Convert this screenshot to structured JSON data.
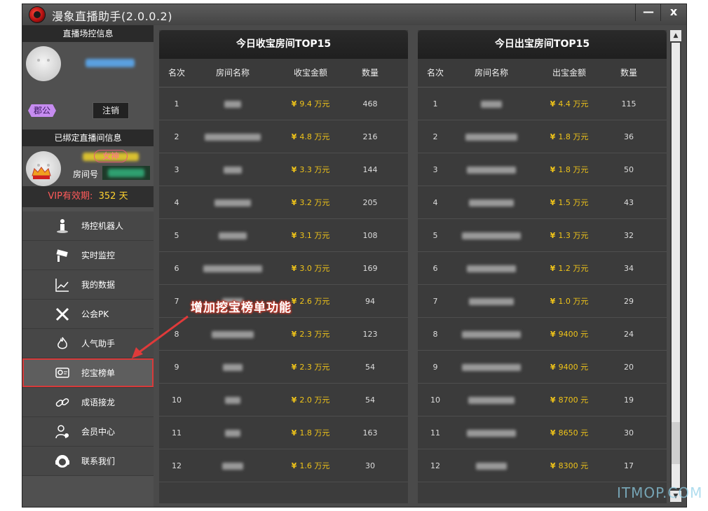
{
  "window": {
    "title": "漫象直播助手(2.0.0.2)",
    "minimize": "—",
    "close": "x"
  },
  "left": {
    "control_header": "直播场控信息",
    "union_badge": "郡公",
    "logout_label": "注销",
    "bound_header": "已绑定直播间信息",
    "goddess_badge": "女神",
    "room_label": "房间号",
    "vip_label": "VIP有效期:",
    "vip_days": "352 天"
  },
  "menu": [
    {
      "label": "场控机器人",
      "icon": "robot-icon"
    },
    {
      "label": "实时监控",
      "icon": "camera-icon"
    },
    {
      "label": "我的数据",
      "icon": "chart-line-icon"
    },
    {
      "label": "公会PK",
      "icon": "swords-icon"
    },
    {
      "label": "人气助手",
      "icon": "flame-icon"
    },
    {
      "label": "挖宝榜单",
      "icon": "treasure-icon",
      "active": true
    },
    {
      "label": "成语接龙",
      "icon": "link-icon"
    },
    {
      "label": "会员中心",
      "icon": "user-gear-icon"
    },
    {
      "label": "联系我们",
      "icon": "headset-icon"
    }
  ],
  "receive_panel": {
    "title": "今日收宝房间TOP15",
    "columns": [
      "名次",
      "房间名称",
      "收宝金额",
      "数量"
    ],
    "rows": [
      {
        "rank": "1",
        "amount": "9.4 万元",
        "count": "468"
      },
      {
        "rank": "2",
        "amount": "4.8 万元",
        "count": "216"
      },
      {
        "rank": "3",
        "amount": "3.3 万元",
        "count": "144"
      },
      {
        "rank": "4",
        "amount": "3.2 万元",
        "count": "205"
      },
      {
        "rank": "5",
        "amount": "3.1 万元",
        "count": "108"
      },
      {
        "rank": "6",
        "amount": "3.0 万元",
        "count": "169"
      },
      {
        "rank": "7",
        "amount": "2.6 万元",
        "count": "94"
      },
      {
        "rank": "8",
        "amount": "2.3 万元",
        "count": "123"
      },
      {
        "rank": "9",
        "amount": "2.3 万元",
        "count": "54"
      },
      {
        "rank": "10",
        "amount": "2.0 万元",
        "count": "54"
      },
      {
        "rank": "11",
        "amount": "1.8 万元",
        "count": "163"
      },
      {
        "rank": "12",
        "amount": "1.6 万元",
        "count": "30"
      }
    ]
  },
  "give_panel": {
    "title": "今日出宝房间TOP15",
    "columns": [
      "名次",
      "房间名称",
      "出宝金额",
      "数量"
    ],
    "rows": [
      {
        "rank": "1",
        "amount": "4.4 万元",
        "count": "115"
      },
      {
        "rank": "2",
        "amount": "1.8 万元",
        "count": "36"
      },
      {
        "rank": "3",
        "amount": "1.8 万元",
        "count": "50"
      },
      {
        "rank": "4",
        "amount": "1.5 万元",
        "count": "43"
      },
      {
        "rank": "5",
        "amount": "1.3 万元",
        "count": "32"
      },
      {
        "rank": "6",
        "amount": "1.2 万元",
        "count": "34"
      },
      {
        "rank": "7",
        "amount": "1.0 万元",
        "count": "29"
      },
      {
        "rank": "8",
        "amount": "9400 元",
        "count": "24"
      },
      {
        "rank": "9",
        "amount": "9400 元",
        "count": "20"
      },
      {
        "rank": "10",
        "amount": "8700 元",
        "count": "19"
      },
      {
        "rank": "11",
        "amount": "8650 元",
        "count": "30"
      },
      {
        "rank": "12",
        "amount": "8300 元",
        "count": "17"
      }
    ]
  },
  "currency_symbol": "¥",
  "annotation": "增加挖宝榜单功能",
  "watermark": "ITMOP.COM",
  "colors": {
    "accent_gold": "#f0c419",
    "vip_red": "#ff5a5a",
    "highlight_red": "#d83a3a"
  }
}
